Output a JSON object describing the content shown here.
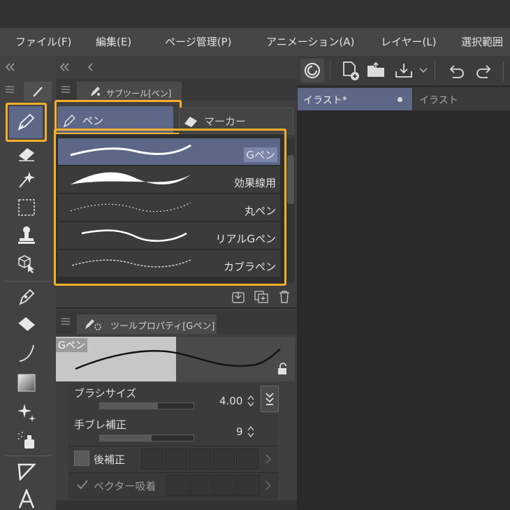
{
  "menu": [
    "ファイル(F)",
    "編集(E)",
    "ページ管理(P)",
    "アニメーション(A)",
    "レイヤー(L)",
    "選択範囲"
  ],
  "subtool_panel": {
    "title": "サブツール[ペン]",
    "tabs": [
      {
        "label": "ペン",
        "selected": true
      },
      {
        "label": "マーカー",
        "selected": false
      }
    ],
    "brushes": [
      {
        "name": "Gペン",
        "selected": true
      },
      {
        "name": "効果線用",
        "selected": false
      },
      {
        "name": "丸ペン",
        "selected": false
      },
      {
        "name": "リアルGペン",
        "selected": false
      },
      {
        "name": "カブラペン",
        "selected": false
      }
    ]
  },
  "tool_property": {
    "title": "ツールプロパティ[Gペン]",
    "preview_label": "Gペン",
    "brush_size": {
      "label": "ブラシサイズ",
      "value": "4.00",
      "fill": 0.62
    },
    "stabilization": {
      "label": "手ブレ補正",
      "value": "9",
      "fill": 0.55
    },
    "post_correction": {
      "label": "後補正",
      "checked": false
    },
    "vector_snap": {
      "label": "ベクター吸着",
      "checked": true
    }
  },
  "canvas_tabs": [
    {
      "label": "イラスト*",
      "active": true
    },
    {
      "label": "イラスト",
      "active": false
    }
  ],
  "colors": {
    "accent_highlight": "#f3b02b",
    "selected_row": "#5d6788",
    "selected_tab": "#5d6788"
  }
}
